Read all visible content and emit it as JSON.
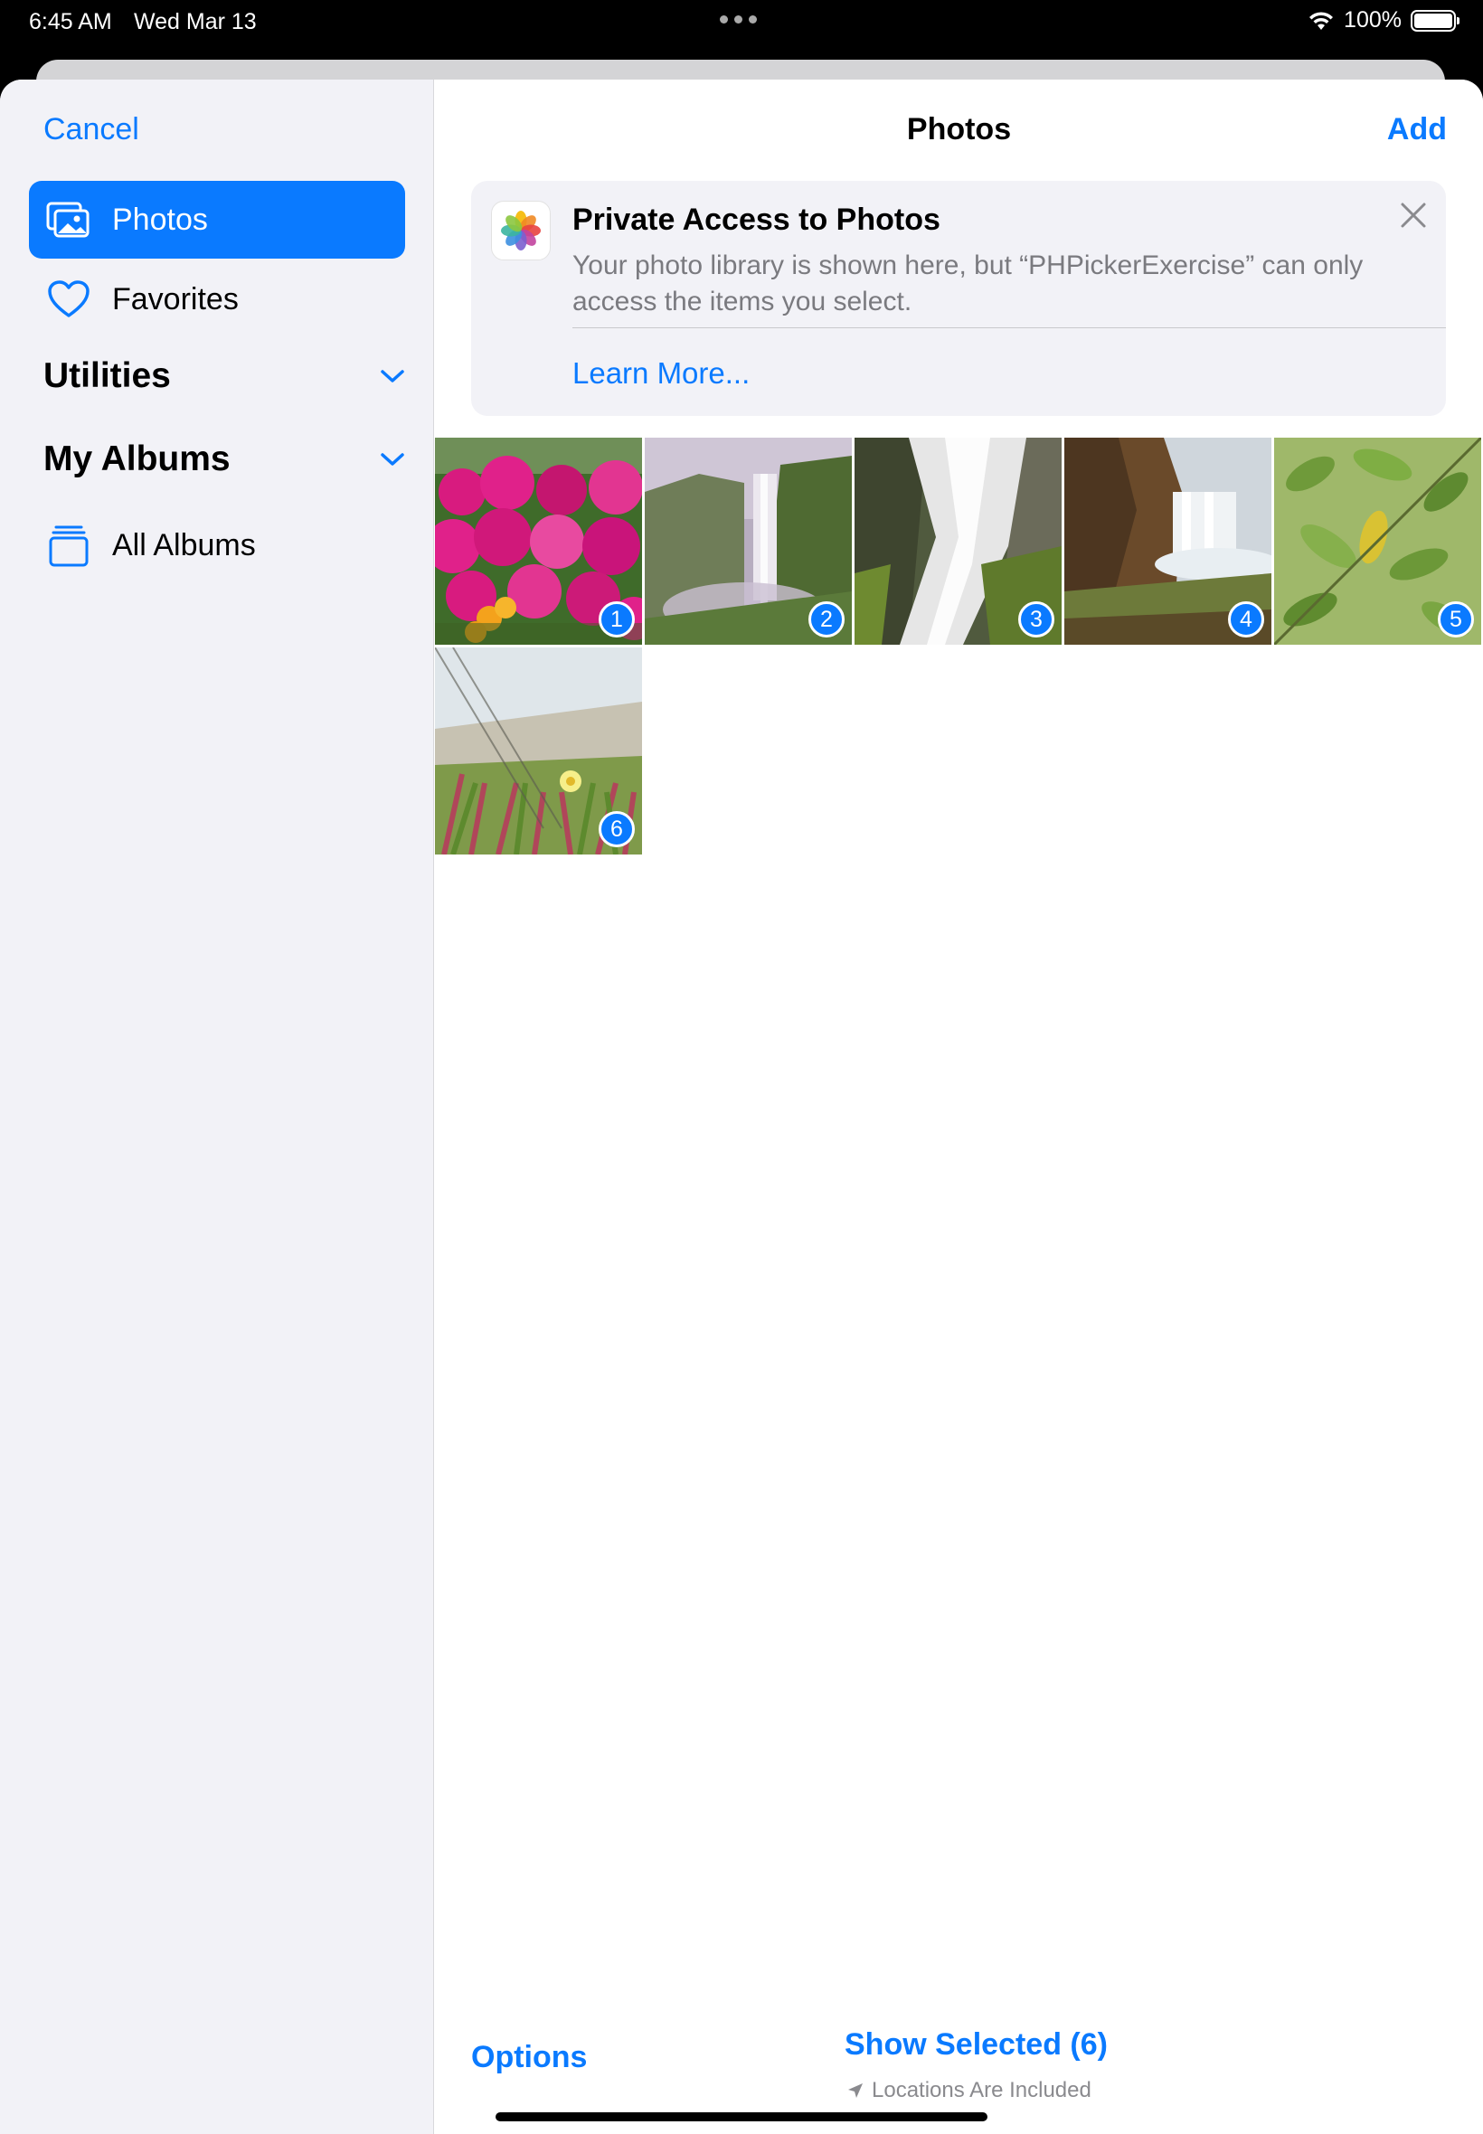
{
  "status_bar": {
    "time": "6:45 AM",
    "date": "Wed Mar 13",
    "battery_text": "100%",
    "battery_level": 1.0
  },
  "sidebar": {
    "cancel_label": "Cancel",
    "items": [
      {
        "label": "Photos",
        "icon": "photos-stack-icon",
        "selected": true
      },
      {
        "label": "Favorites",
        "icon": "heart-icon",
        "selected": false
      }
    ],
    "sections": [
      {
        "title": "Utilities",
        "icon": "chevron-down-icon"
      },
      {
        "title": "My Albums",
        "icon": "chevron-down-icon"
      }
    ],
    "album_items": [
      {
        "label": "All Albums",
        "icon": "albums-stack-icon"
      }
    ]
  },
  "content": {
    "title": "Photos",
    "add_label": "Add",
    "banner": {
      "title": "Private Access to Photos",
      "body": "Your photo library is shown here, but “PHPickerExercise” can only access the items you select.",
      "link": "Learn More...",
      "icon": "photos-app-icon",
      "close_icon": "close-icon"
    },
    "photos": [
      {
        "badge": "1",
        "subject": "pink flowers"
      },
      {
        "badge": "2",
        "subject": "waterfall cliff"
      },
      {
        "badge": "3",
        "subject": "waterfall close-up"
      },
      {
        "badge": "4",
        "subject": "waterfall landscape"
      },
      {
        "badge": "5",
        "subject": "green leaves"
      },
      {
        "badge": "6",
        "subject": "yellow flower in grass"
      }
    ],
    "footer": {
      "options_label": "Options",
      "show_selected_label": "Show Selected (6)",
      "locations_label": "Locations Are Included",
      "locations_icon": "location-arrow-icon"
    }
  },
  "colors": {
    "accent": "#0a7aff",
    "sidebar_bg": "#f2f2f7",
    "secondary_text": "#7a7a7f"
  }
}
